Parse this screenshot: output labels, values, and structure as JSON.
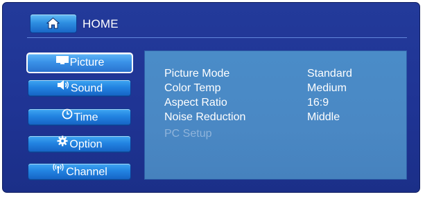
{
  "header": {
    "title": "HOME",
    "icon": "home-icon"
  },
  "menu": {
    "items": [
      {
        "label": "Picture",
        "icon": "monitor-icon",
        "selected": true
      },
      {
        "label": "Sound",
        "icon": "speaker-icon",
        "selected": false
      },
      {
        "label": "Time",
        "icon": "clock-icon",
        "selected": false
      },
      {
        "label": "Option",
        "icon": "gear-icon",
        "selected": false
      },
      {
        "label": "Channel",
        "icon": "antenna-icon",
        "selected": false
      }
    ]
  },
  "settings": {
    "rows": [
      {
        "name": "Picture Mode",
        "value": "Standard",
        "enabled": true
      },
      {
        "name": "Color Temp",
        "value": "Medium",
        "enabled": true
      },
      {
        "name": "Aspect Ratio",
        "value": "16:9",
        "enabled": true
      },
      {
        "name": "Noise Reduction",
        "value": "Middle",
        "enabled": true
      },
      {
        "name": "PC Setup",
        "value": "",
        "enabled": false
      }
    ]
  },
  "colors": {
    "background": "#1f3494",
    "button": "#2283e1",
    "panel": "#4a88c4",
    "text": "#ffffff",
    "disabled_text": "#8fb4db"
  }
}
